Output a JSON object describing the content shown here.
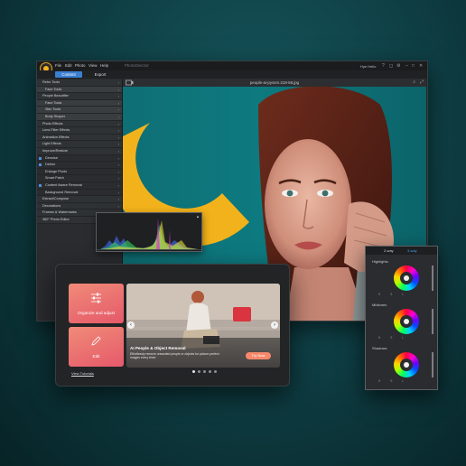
{
  "menubar": {
    "items": [
      "File",
      "Edit",
      "Photo",
      "View",
      "Help"
    ],
    "app_name": "PhotoDirector",
    "user_label": "Hye Hello",
    "controls": [
      "?",
      "◻",
      "⚙",
      "–",
      "□",
      "✕"
    ]
  },
  "tabs": [
    "Content",
    "Export"
  ],
  "canvas": {
    "filename": "people-ai-pyssm.218-58.jpg"
  },
  "sidebar": {
    "items": [
      {
        "label": "Retro Tools",
        "kind": "group"
      },
      {
        "label": "Face Tools",
        "kind": "sub"
      },
      {
        "label": "People Beautifier",
        "kind": "group"
      },
      {
        "label": "Face Tools",
        "kind": "sub"
      },
      {
        "label": "Skin Tools",
        "kind": "sub"
      },
      {
        "label": "Body Shaper",
        "kind": "sub"
      },
      {
        "label": "Photo Effects",
        "kind": "group"
      },
      {
        "label": "Lens Filter Effects",
        "kind": "group"
      },
      {
        "label": "Animation Effects",
        "kind": "group"
      },
      {
        "label": "Light Effects",
        "kind": "group"
      },
      {
        "label": "Improve/Restore",
        "kind": "group"
      },
      {
        "label": "Denoise",
        "kind": "check"
      },
      {
        "label": "Deblur",
        "kind": "check"
      },
      {
        "label": "Enlarge Photo",
        "kind": "item"
      },
      {
        "label": "Smart Patch",
        "kind": "item"
      },
      {
        "label": "Content Aware Removal",
        "kind": "check"
      },
      {
        "label": "Background Removal",
        "kind": "item"
      },
      {
        "label": "Extract/Compose",
        "kind": "group"
      },
      {
        "label": "Decorations",
        "kind": "group"
      },
      {
        "label": "Frames & Watermarks",
        "kind": "group"
      },
      {
        "label": "360° Photo Editor",
        "kind": "group"
      }
    ]
  },
  "discover": {
    "card1": "Organize and adjust",
    "card2": "Edit",
    "footer_link": "View Tutorials",
    "banner_title": "AI People & Object Removal",
    "banner_text": "Effortlessly remove unwanted people or objects for picture-perfect images every time!",
    "try_label": "Try Now",
    "prev": "‹",
    "next": "›"
  },
  "color_panel": {
    "tabs": [
      "2-way",
      "3-way"
    ],
    "labels": [
      "Highlights",
      "Midtones",
      "Shadows"
    ],
    "values": "H S L"
  },
  "colors": {
    "accent": "#3b7fd1",
    "brand": "#f4b21e",
    "card": "#ef7d78",
    "teal_bg": "#0f4147"
  }
}
